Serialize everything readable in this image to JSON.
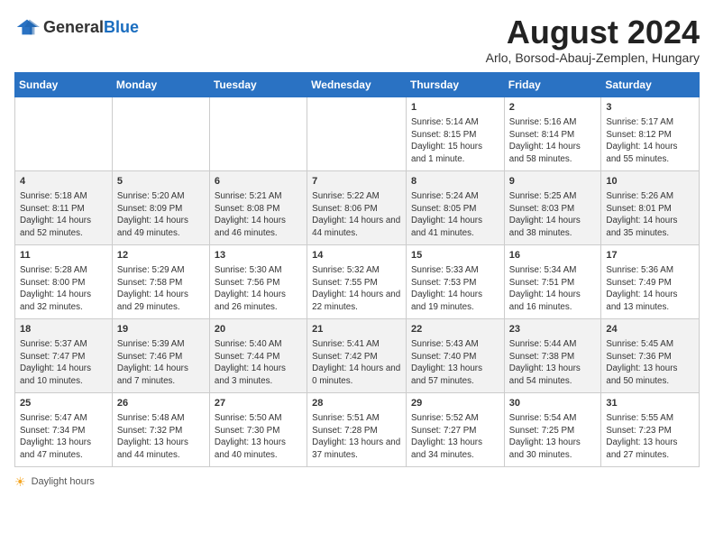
{
  "header": {
    "logo_general": "General",
    "logo_blue": "Blue",
    "month_title": "August 2024",
    "location": "Arlo, Borsod-Abauj-Zemplen, Hungary"
  },
  "columns": [
    "Sunday",
    "Monday",
    "Tuesday",
    "Wednesday",
    "Thursday",
    "Friday",
    "Saturday"
  ],
  "weeks": [
    [
      {
        "day": "",
        "info": ""
      },
      {
        "day": "",
        "info": ""
      },
      {
        "day": "",
        "info": ""
      },
      {
        "day": "",
        "info": ""
      },
      {
        "day": "1",
        "info": "Sunrise: 5:14 AM\nSunset: 8:15 PM\nDaylight: 15 hours and 1 minute."
      },
      {
        "day": "2",
        "info": "Sunrise: 5:16 AM\nSunset: 8:14 PM\nDaylight: 14 hours and 58 minutes."
      },
      {
        "day": "3",
        "info": "Sunrise: 5:17 AM\nSunset: 8:12 PM\nDaylight: 14 hours and 55 minutes."
      }
    ],
    [
      {
        "day": "4",
        "info": "Sunrise: 5:18 AM\nSunset: 8:11 PM\nDaylight: 14 hours and 52 minutes."
      },
      {
        "day": "5",
        "info": "Sunrise: 5:20 AM\nSunset: 8:09 PM\nDaylight: 14 hours and 49 minutes."
      },
      {
        "day": "6",
        "info": "Sunrise: 5:21 AM\nSunset: 8:08 PM\nDaylight: 14 hours and 46 minutes."
      },
      {
        "day": "7",
        "info": "Sunrise: 5:22 AM\nSunset: 8:06 PM\nDaylight: 14 hours and 44 minutes."
      },
      {
        "day": "8",
        "info": "Sunrise: 5:24 AM\nSunset: 8:05 PM\nDaylight: 14 hours and 41 minutes."
      },
      {
        "day": "9",
        "info": "Sunrise: 5:25 AM\nSunset: 8:03 PM\nDaylight: 14 hours and 38 minutes."
      },
      {
        "day": "10",
        "info": "Sunrise: 5:26 AM\nSunset: 8:01 PM\nDaylight: 14 hours and 35 minutes."
      }
    ],
    [
      {
        "day": "11",
        "info": "Sunrise: 5:28 AM\nSunset: 8:00 PM\nDaylight: 14 hours and 32 minutes."
      },
      {
        "day": "12",
        "info": "Sunrise: 5:29 AM\nSunset: 7:58 PM\nDaylight: 14 hours and 29 minutes."
      },
      {
        "day": "13",
        "info": "Sunrise: 5:30 AM\nSunset: 7:56 PM\nDaylight: 14 hours and 26 minutes."
      },
      {
        "day": "14",
        "info": "Sunrise: 5:32 AM\nSunset: 7:55 PM\nDaylight: 14 hours and 22 minutes."
      },
      {
        "day": "15",
        "info": "Sunrise: 5:33 AM\nSunset: 7:53 PM\nDaylight: 14 hours and 19 minutes."
      },
      {
        "day": "16",
        "info": "Sunrise: 5:34 AM\nSunset: 7:51 PM\nDaylight: 14 hours and 16 minutes."
      },
      {
        "day": "17",
        "info": "Sunrise: 5:36 AM\nSunset: 7:49 PM\nDaylight: 14 hours and 13 minutes."
      }
    ],
    [
      {
        "day": "18",
        "info": "Sunrise: 5:37 AM\nSunset: 7:47 PM\nDaylight: 14 hours and 10 minutes."
      },
      {
        "day": "19",
        "info": "Sunrise: 5:39 AM\nSunset: 7:46 PM\nDaylight: 14 hours and 7 minutes."
      },
      {
        "day": "20",
        "info": "Sunrise: 5:40 AM\nSunset: 7:44 PM\nDaylight: 14 hours and 3 minutes."
      },
      {
        "day": "21",
        "info": "Sunrise: 5:41 AM\nSunset: 7:42 PM\nDaylight: 14 hours and 0 minutes."
      },
      {
        "day": "22",
        "info": "Sunrise: 5:43 AM\nSunset: 7:40 PM\nDaylight: 13 hours and 57 minutes."
      },
      {
        "day": "23",
        "info": "Sunrise: 5:44 AM\nSunset: 7:38 PM\nDaylight: 13 hours and 54 minutes."
      },
      {
        "day": "24",
        "info": "Sunrise: 5:45 AM\nSunset: 7:36 PM\nDaylight: 13 hours and 50 minutes."
      }
    ],
    [
      {
        "day": "25",
        "info": "Sunrise: 5:47 AM\nSunset: 7:34 PM\nDaylight: 13 hours and 47 minutes."
      },
      {
        "day": "26",
        "info": "Sunrise: 5:48 AM\nSunset: 7:32 PM\nDaylight: 13 hours and 44 minutes."
      },
      {
        "day": "27",
        "info": "Sunrise: 5:50 AM\nSunset: 7:30 PM\nDaylight: 13 hours and 40 minutes."
      },
      {
        "day": "28",
        "info": "Sunrise: 5:51 AM\nSunset: 7:28 PM\nDaylight: 13 hours and 37 minutes."
      },
      {
        "day": "29",
        "info": "Sunrise: 5:52 AM\nSunset: 7:27 PM\nDaylight: 13 hours and 34 minutes."
      },
      {
        "day": "30",
        "info": "Sunrise: 5:54 AM\nSunset: 7:25 PM\nDaylight: 13 hours and 30 minutes."
      },
      {
        "day": "31",
        "info": "Sunrise: 5:55 AM\nSunset: 7:23 PM\nDaylight: 13 hours and 27 minutes."
      }
    ]
  ],
  "footer": {
    "daylight_label": "Daylight hours"
  }
}
